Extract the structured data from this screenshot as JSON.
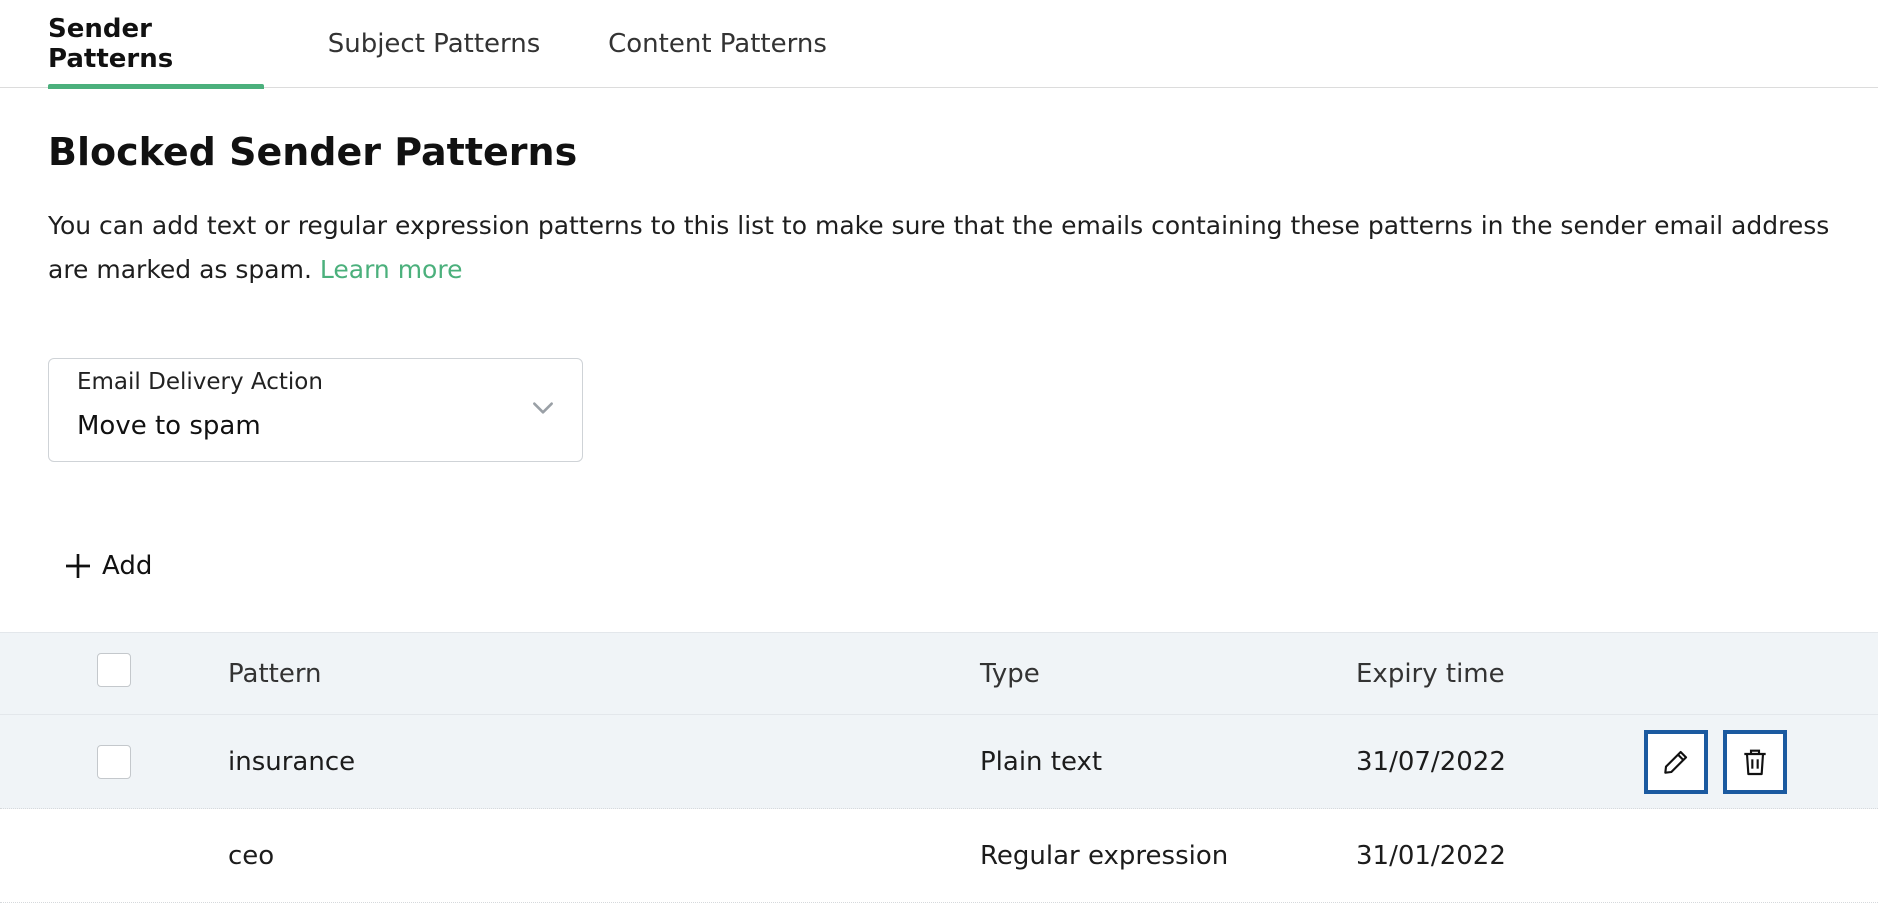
{
  "tabs": [
    {
      "label": "Sender Patterns",
      "active": true
    },
    {
      "label": "Subject Patterns",
      "active": false
    },
    {
      "label": "Content Patterns",
      "active": false
    }
  ],
  "page": {
    "title": "Blocked Sender Patterns",
    "description": "You can add text or regular expression patterns to this list to make sure that the emails containing these patterns in the sender email address are marked as spam.",
    "learn_more": "Learn more"
  },
  "delivery_action": {
    "label": "Email Delivery Action",
    "value": "Move to spam"
  },
  "toolbar": {
    "add_label": "Add"
  },
  "table": {
    "columns": [
      "Pattern",
      "Type",
      "Expiry time"
    ],
    "rows": [
      {
        "pattern": "insurance",
        "type": "Plain text",
        "expiry": "31/07/2022"
      },
      {
        "pattern": "ceo",
        "type": "Regular expression",
        "expiry": "31/01/2022"
      }
    ]
  },
  "colors": {
    "accent": "#4bb07c",
    "header_bg": "#f0f4f7",
    "focus_outline": "#1b5aa0"
  },
  "icons": {
    "add": "plus-icon",
    "dropdown": "chevron-down-icon",
    "edit": "pencil-icon",
    "delete": "trash-icon"
  }
}
